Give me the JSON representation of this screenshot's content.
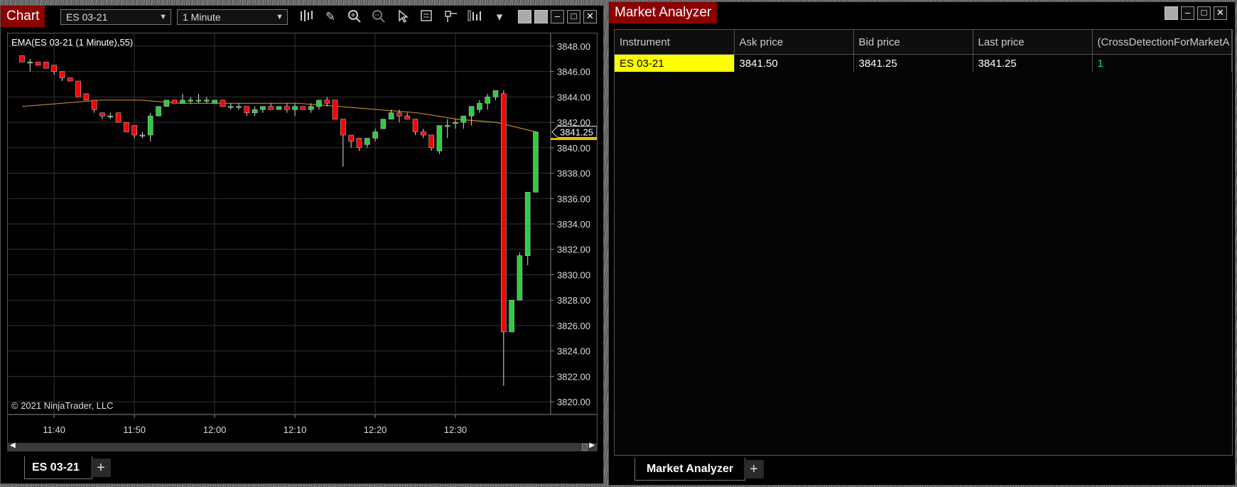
{
  "chart_window": {
    "title": "Chart",
    "instrument": "ES 03-21",
    "interval": "1 Minute",
    "indicator_label": "EMA(ES 03-21 (1 Minute),55)",
    "copyright": "© 2021 NinjaTrader, LLC",
    "last_price_label": "3841.25",
    "tab_label": "ES 03-21",
    "add_tab": "+",
    "close_glyph": "✕",
    "min_glyph": "–",
    "max_glyph": "□"
  },
  "analyzer_window": {
    "title": "Market Analyzer",
    "tab_label": "Market Analyzer",
    "add_tab": "+",
    "columns": [
      "Instrument",
      "Ask price",
      "Bid price",
      "Last price",
      "(CrossDetectionForMarketA"
    ],
    "rows": [
      {
        "instrument": "ES 03-21",
        "ask": "3841.50",
        "bid": "3841.25",
        "last": "3841.25",
        "cross": "1"
      }
    ]
  },
  "colors": {
    "up": "#2ecc40",
    "down": "#ff0000",
    "ema": "#c8862a",
    "title": "#8b0000",
    "selected": "#ffff00"
  },
  "chart_data": {
    "type": "candlestick",
    "title": "",
    "ylim": [
      3819,
      3849
    ],
    "y_ticks": [
      "3848.00",
      "3846.00",
      "3844.00",
      "3842.00",
      "3840.00",
      "3838.00",
      "3836.00",
      "3834.00",
      "3832.00",
      "3830.00",
      "3828.00",
      "3826.00",
      "3824.00",
      "3822.00",
      "3820.00"
    ],
    "x_ticks": [
      "11:40",
      "11:50",
      "12:00",
      "12:10",
      "12:20",
      "12:30"
    ],
    "candles": [
      [
        3847.25,
        3847.25,
        3846.75,
        3846.75
      ],
      [
        3846.75,
        3847.0,
        3846.0,
        3846.75
      ],
      [
        3846.75,
        3846.75,
        3846.5,
        3846.5
      ],
      [
        3846.75,
        3846.75,
        3846.25,
        3846.25
      ],
      [
        3846.5,
        3846.5,
        3845.75,
        3846.0
      ],
      [
        3846.0,
        3846.0,
        3845.25,
        3845.5
      ],
      [
        3845.5,
        3845.5,
        3845.25,
        3845.25
      ],
      [
        3845.25,
        3845.25,
        3844.0,
        3844.0
      ],
      [
        3844.25,
        3844.25,
        3843.75,
        3843.75
      ],
      [
        3843.75,
        3843.75,
        3842.75,
        3843.0
      ],
      [
        3842.75,
        3842.75,
        3842.25,
        3842.5
      ],
      [
        3842.5,
        3842.75,
        3842.25,
        3842.5
      ],
      [
        3842.75,
        3842.75,
        3842.0,
        3842.0
      ],
      [
        3842.0,
        3842.0,
        3841.25,
        3841.25
      ],
      [
        3841.75,
        3841.75,
        3840.75,
        3841.0
      ],
      [
        3841.0,
        3841.25,
        3840.75,
        3841.0
      ],
      [
        3841.0,
        3842.75,
        3840.5,
        3842.5
      ],
      [
        3842.5,
        3843.25,
        3842.5,
        3843.25
      ],
      [
        3843.25,
        3843.75,
        3843.25,
        3843.75
      ],
      [
        3843.75,
        3843.75,
        3843.5,
        3843.5
      ],
      [
        3843.5,
        3844.25,
        3843.5,
        3843.75
      ],
      [
        3843.75,
        3844.0,
        3843.5,
        3843.75
      ],
      [
        3843.75,
        3844.25,
        3843.5,
        3843.75
      ],
      [
        3843.75,
        3844.0,
        3843.5,
        3843.75
      ],
      [
        3843.5,
        3843.75,
        3843.5,
        3843.75
      ],
      [
        3843.75,
        3843.75,
        3843.25,
        3843.25
      ],
      [
        3843.25,
        3843.5,
        3843.0,
        3843.25
      ],
      [
        3843.25,
        3843.5,
        3843.0,
        3843.25
      ],
      [
        3843.25,
        3843.25,
        3842.5,
        3842.75
      ],
      [
        3842.75,
        3843.25,
        3842.5,
        3843.0
      ],
      [
        3843.0,
        3843.25,
        3842.75,
        3843.25
      ],
      [
        3843.25,
        3843.5,
        3843.0,
        3843.0
      ],
      [
        3843.0,
        3843.25,
        3843.0,
        3843.25
      ],
      [
        3843.25,
        3843.5,
        3842.75,
        3843.0
      ],
      [
        3843.0,
        3843.5,
        3842.5,
        3843.25
      ],
      [
        3843.25,
        3843.25,
        3843.0,
        3843.0
      ],
      [
        3843.0,
        3843.5,
        3842.75,
        3843.25
      ],
      [
        3843.25,
        3843.75,
        3843.0,
        3843.75
      ],
      [
        3843.75,
        3844.0,
        3843.25,
        3843.5
      ],
      [
        3843.75,
        3843.75,
        3842.25,
        3842.25
      ],
      [
        3842.25,
        3842.25,
        3838.5,
        3841.0
      ],
      [
        3841.0,
        3841.0,
        3840.0,
        3840.5
      ],
      [
        3840.75,
        3840.75,
        3839.75,
        3840.0
      ],
      [
        3840.25,
        3840.75,
        3840.0,
        3840.75
      ],
      [
        3840.75,
        3841.5,
        3840.5,
        3841.25
      ],
      [
        3841.5,
        3842.25,
        3841.5,
        3842.25
      ],
      [
        3842.25,
        3843.0,
        3842.25,
        3842.75
      ],
      [
        3842.75,
        3843.0,
        3842.0,
        3842.5
      ],
      [
        3842.5,
        3842.75,
        3842.25,
        3842.25
      ],
      [
        3842.25,
        3842.25,
        3841.0,
        3841.25
      ],
      [
        3841.25,
        3841.5,
        3840.75,
        3841.0
      ],
      [
        3841.0,
        3841.0,
        3839.75,
        3840.0
      ],
      [
        3839.75,
        3841.75,
        3839.5,
        3841.75
      ],
      [
        3841.75,
        3842.25,
        3840.75,
        3841.75
      ],
      [
        3842.0,
        3842.25,
        3841.5,
        3842.0
      ],
      [
        3842.0,
        3842.5,
        3841.5,
        3842.5
      ],
      [
        3842.5,
        3843.25,
        3841.75,
        3843.25
      ],
      [
        3843.0,
        3843.75,
        3842.75,
        3843.5
      ],
      [
        3843.5,
        3844.25,
        3843.0,
        3844.0
      ],
      [
        3844.0,
        3844.5,
        3843.75,
        3844.5
      ],
      [
        3844.25,
        3844.5,
        3821.25,
        3825.5
      ],
      [
        3825.5,
        3828.0,
        3825.5,
        3828.0
      ],
      [
        3828.0,
        3831.75,
        3828.0,
        3831.5
      ],
      [
        3831.5,
        3836.5,
        3830.75,
        3836.5
      ],
      [
        3836.5,
        3841.25,
        3836.5,
        3841.25
      ]
    ],
    "ema": [
      3843.25,
      3843.5,
      3843.75,
      3843.75,
      3843.5,
      3843.5,
      3843.5,
      3843.5,
      3843.25,
      3843.0,
      3842.75,
      3842.25,
      3842.0,
      3841.25
    ]
  }
}
